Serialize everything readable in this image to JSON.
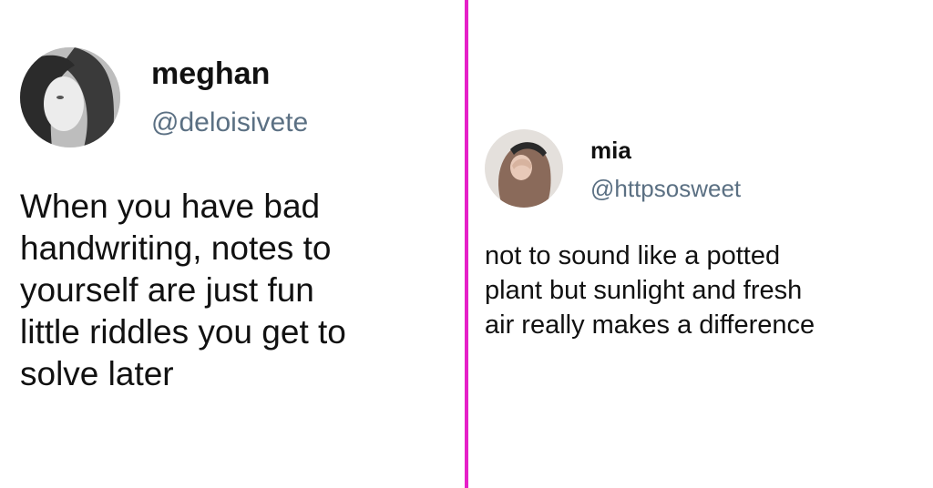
{
  "colors": {
    "divider": "#e620c8",
    "text": "#111111",
    "handle": "#5b7083"
  },
  "tweets": [
    {
      "name": "meghan",
      "handle": "@deloisivete",
      "text": "When you have bad\nhandwriting, notes to\nyourself are just fun\nlittle riddles you get to\nsolve later",
      "avatar_icon": "avatar-photo-icon"
    },
    {
      "name": "mia",
      "handle": "@httpsosweet",
      "text": "not to sound like a potted\nplant but sunlight and fresh\nair really makes a difference",
      "avatar_icon": "avatar-photo-icon"
    }
  ]
}
